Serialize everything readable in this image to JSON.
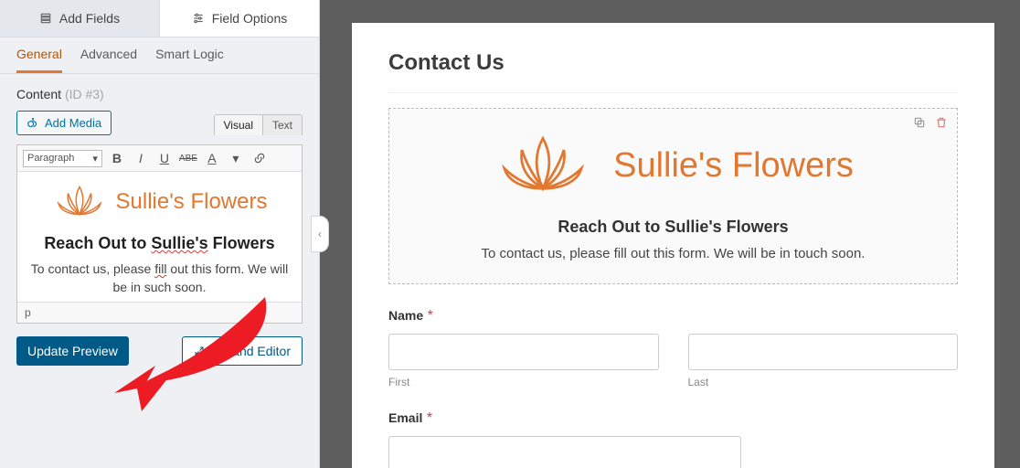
{
  "sidebar": {
    "tabs": {
      "add_fields": "Add Fields",
      "field_options": "Field Options"
    },
    "subtabs": {
      "general": "General",
      "advanced": "Advanced",
      "smart_logic": "Smart Logic"
    },
    "content_label": "Content",
    "content_id": "(ID #3)",
    "add_media": "Add Media",
    "editor_tabs": {
      "visual": "Visual",
      "text": "Text"
    },
    "toolbar": {
      "paragraph": "Paragraph",
      "strike_abbr": "ABE",
      "color_letter": "A"
    },
    "brand": "Sullie's Flowers",
    "heading_pre": "Reach Out to ",
    "heading_mid": "Sullie's",
    "heading_post": " Flowers",
    "paragraph_a": "To contact us, please ",
    "paragraph_b": "fill",
    "paragraph_c": " out this form. We will be in ",
    "paragraph_d": " such",
    "paragraph_e": " soon.",
    "statusbar": "p",
    "update_btn": "Update Preview",
    "expand_btn": "Expand Editor"
  },
  "preview": {
    "page_title": "Contact Us",
    "brand": "Sullie's Flowers",
    "heading": "Reach Out to Sullie's Flowers",
    "paragraph": "To contact us, please fill out this form. We will be in touch soon.",
    "name_label": "Name",
    "first": "First",
    "last": "Last",
    "email_label": "Email",
    "required_marker": "*"
  }
}
